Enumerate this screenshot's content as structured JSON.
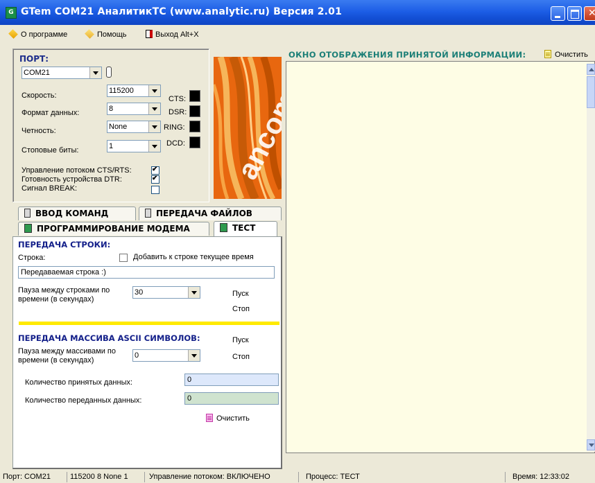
{
  "window": {
    "title": "GTem   COM21   АналитикТС (www.analytic.ru)   Версия 2.01",
    "icon_label": "G"
  },
  "menu": {
    "about": "О программе",
    "help": "Помощь",
    "exit": "Выход Alt+X"
  },
  "port_panel": {
    "title": "ПОРТ:",
    "port_value": "COM21",
    "speed_label": "Скорость:",
    "speed_value": "115200",
    "format_label": "Формат данных:",
    "format_value": "8",
    "parity_label": "Четность:",
    "parity_value": "None",
    "stopbits_label": "Стоповые биты:",
    "stopbits_value": "1",
    "signals": {
      "cts": "CTS:",
      "dsr": "DSR:",
      "ring": "RING:",
      "dcd": "DCD:"
    },
    "flow_control_label": "Управление потоком CTS/RTS:",
    "flow_control_checked": true,
    "dtr_label": "Готовность устройства DTR:",
    "dtr_checked": true,
    "break_label": "Сигнал BREAK:",
    "break_checked": false
  },
  "display": {
    "title": "ОКНО ОТОБРАЖЕНИЯ ПРИНЯТОЙ ИНФОРМАЦИИ:",
    "clear_label": "Очистить"
  },
  "tabs": {
    "commands": "ВВОД КОМАНД",
    "files": "ПЕРЕДАЧА ФАЙЛОВ",
    "modem": "ПРОГРАММИРОВАНИЕ МОДЕМА",
    "test": "ТЕСТ"
  },
  "test_tab": {
    "string_section_title": "ПЕРЕДАЧА СТРОКИ:",
    "string_label": "Строка:",
    "add_time_label": "Добавить к строке текущее время",
    "add_time_checked": false,
    "string_value": "Передаваемая строка :)",
    "pause_label_line1": "Пауза между строками по",
    "pause_label_line2": "времени (в секундах)",
    "pause_value": "30",
    "start_label": "Пуск",
    "stop_label": "Стоп",
    "ascii_section_title": "ПЕРЕДАЧА МАССИВА ASCII СИМВОЛОВ:",
    "ascii_start_label": "Пуск",
    "ascii_pause_label_line1": "Пауза между массивами по",
    "ascii_pause_label_line2": "времени (в секундах)",
    "ascii_pause_value": "0",
    "ascii_stop_label": "Стоп",
    "received_label": "Количество принятых данных:",
    "received_value": "0",
    "sent_label": "Количество переданных данных:",
    "sent_value": "0",
    "clear_label": "Очистить"
  },
  "statusbar": {
    "port": "Порт: COM21",
    "params": "115200 8 None 1",
    "flow": "Управление потоком: ВКЛЮЧЕНО",
    "process": "Процесс: ТЕСТ",
    "time": "Время: 12:33:02"
  },
  "colors": {
    "title_bar": "#1d5ee6",
    "section_title": "#14208a",
    "display_title": "#1c7f77",
    "display_bg": "#fefde5",
    "separator": "#ffea00",
    "received_field_bg": "#dde8fb",
    "sent_field_bg": "#cfe3cf",
    "logo_orange": "#ea6a12"
  }
}
